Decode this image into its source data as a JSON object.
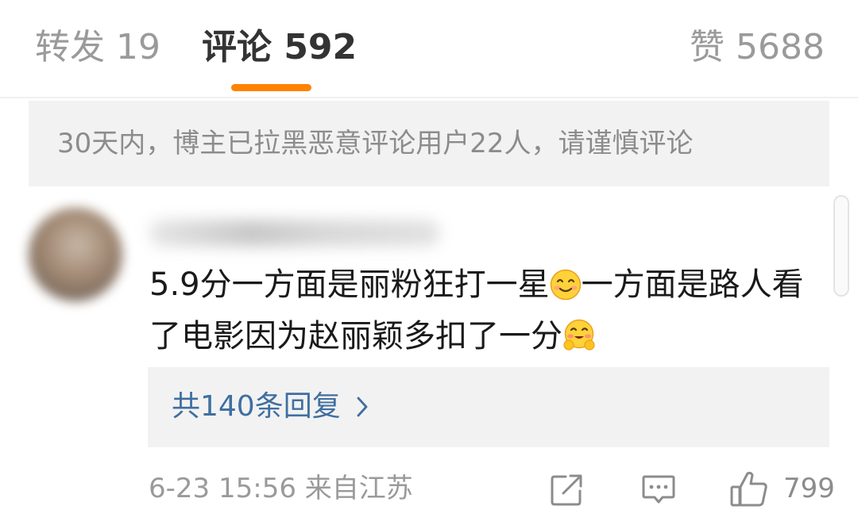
{
  "tabs": {
    "repost": "转发 19",
    "comments": "评论 592",
    "likes": "赞 5688",
    "active": "comments",
    "accent_color": "#ff8200"
  },
  "notice": {
    "text": "30天内，博主已拉黑恶意评论用户22人，请谨慎评论"
  },
  "comment": {
    "avatar": "blurred-avatar",
    "username": "",
    "text_part1": "5.9分一方面是丽粉狂打一星",
    "emoji1": "smile-emoji",
    "text_part2": "一方面是路人看了电影因为赵丽颖多扣了一分",
    "emoji2": "hug-emoji",
    "replies_label": "共140条回复",
    "replies_color": "#3f6fa0",
    "meta": "6-23 15:56 来自江苏",
    "like_count": "799",
    "icons": [
      "share-icon",
      "comment-icon",
      "like-icon",
      "chevron-right-icon"
    ]
  }
}
